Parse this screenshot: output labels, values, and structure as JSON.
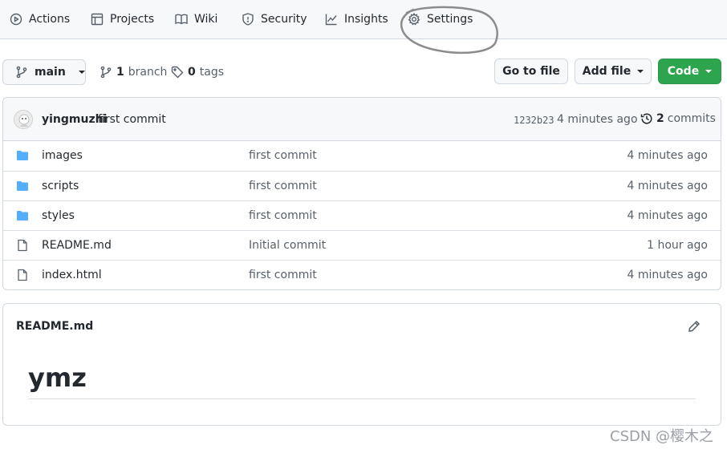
{
  "nav": {
    "tabs": [
      {
        "label": "Actions",
        "icon": "play-circle-icon"
      },
      {
        "label": "Projects",
        "icon": "table-icon"
      },
      {
        "label": "Wiki",
        "icon": "book-icon"
      },
      {
        "label": "Security",
        "icon": "shield-icon"
      },
      {
        "label": "Insights",
        "icon": "graph-icon"
      },
      {
        "label": "Settings",
        "icon": "gear-icon"
      }
    ]
  },
  "toolbar": {
    "branch_name": "main",
    "branch_count": "1",
    "branch_word": "branch",
    "tag_count": "0",
    "tag_word": "tags",
    "goto_file": "Go to file",
    "add_file": "Add file",
    "code": "Code"
  },
  "commit": {
    "user": "yingmuzhi",
    "message": "first commit",
    "sha": "1232b23",
    "time": "4 minutes ago",
    "commit_count": "2",
    "commit_word": "commits"
  },
  "files": [
    {
      "name": "images",
      "type": "folder",
      "message": "first commit",
      "time": "4 minutes ago"
    },
    {
      "name": "scripts",
      "type": "folder",
      "message": "first commit",
      "time": "4 minutes ago"
    },
    {
      "name": "styles",
      "type": "folder",
      "message": "first commit",
      "time": "4 minutes ago"
    },
    {
      "name": "README.md",
      "type": "file",
      "message": "Initial commit",
      "time": "1 hour ago"
    },
    {
      "name": "index.html",
      "type": "file",
      "message": "first commit",
      "time": "4 minutes ago"
    }
  ],
  "readme": {
    "title": "README.md",
    "heading": "ymz"
  },
  "watermark": "CSDN @樱木之",
  "colors": {
    "accent_green": "#2da44e",
    "folder_blue": "#54aeff",
    "annotation_gray": "#8c8c8c"
  }
}
